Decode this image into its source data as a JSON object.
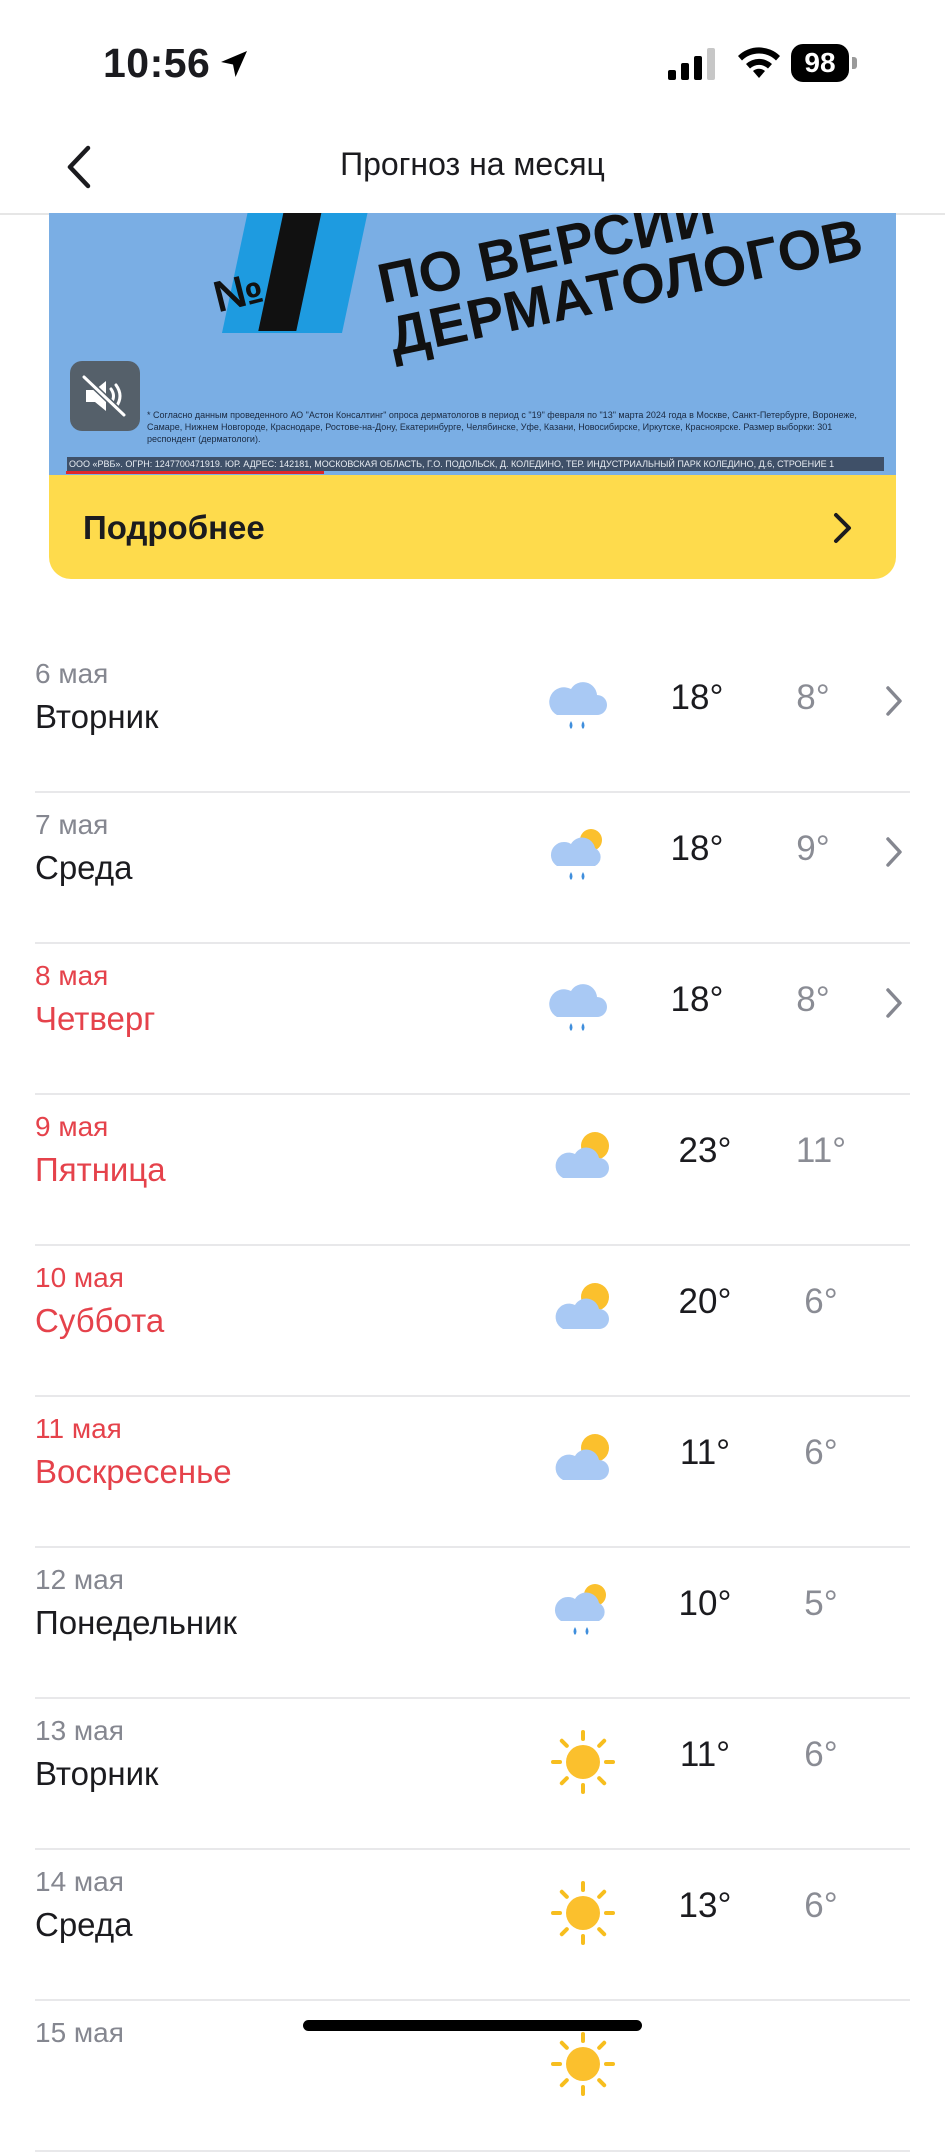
{
  "status_bar": {
    "time": "10:56",
    "battery": "98"
  },
  "nav": {
    "title": "Прогноз на месяц"
  },
  "ad": {
    "no_mark": "№",
    "headline": "ПО ВЕРСИИ\nДЕРМАТОЛОГОВ",
    "disclaimer": "* Согласно данным проведенного АО \"Астон Консалтинг\" опроса дерматологов в период с \"19\" февраля по \"13\" марта 2024 года в Москве, Санкт-Петербурге, Воронеже, Самаре, Нижнем Новгороде, Краснодаре, Ростове-на-Дону, Екатеринбурге, Челябинске, Уфе, Казани, Новосибирске, Иркутске, Красноярске. Размер выборки: 301 респондент (дерматологи).",
    "legal": "ООО «РВБ». ОГРН: 1247700471919. ЮР. АДРЕС: 142181, МОСКОВСКАЯ ОБЛАСТЬ, Г.О. ПОДОЛЬСК, Д. КОЛЕДИНО, ТЕР. ИНДУСТРИАЛЬНЫЙ ПАРК КОЛЕДИНО, Д.6, СТРОЕНИЕ 1",
    "cta_label": "Подробнее"
  },
  "days": [
    {
      "date": "6 мая",
      "weekday": "Вторник",
      "weekend": false,
      "icon": "cloud-rain-icon",
      "high": "18°",
      "low": "8°",
      "chevron": true
    },
    {
      "date": "7 мая",
      "weekday": "Среда",
      "weekend": false,
      "icon": "sun-cloud-rain-icon",
      "high": "18°",
      "low": "9°",
      "chevron": true
    },
    {
      "date": "8 мая",
      "weekday": "Четверг",
      "weekend": true,
      "icon": "cloud-rain-icon",
      "high": "18°",
      "low": "8°",
      "chevron": true
    },
    {
      "date": "9 мая",
      "weekday": "Пятница",
      "weekend": true,
      "icon": "partly-cloudy-icon",
      "high": "23°",
      "low": "11°",
      "chevron": false
    },
    {
      "date": "10 мая",
      "weekday": "Суббота",
      "weekend": true,
      "icon": "partly-cloudy-icon",
      "high": "20°",
      "low": "6°",
      "chevron": false
    },
    {
      "date": "11 мая",
      "weekday": "Воскресенье",
      "weekend": true,
      "icon": "partly-cloudy-icon",
      "high": "11°",
      "low": "6°",
      "chevron": false
    },
    {
      "date": "12 мая",
      "weekday": "Понедельник",
      "weekend": false,
      "icon": "sun-cloud-rain-icon",
      "high": "10°",
      "low": "5°",
      "chevron": false
    },
    {
      "date": "13 мая",
      "weekday": "Вторник",
      "weekend": false,
      "icon": "sun-icon",
      "high": "11°",
      "low": "6°",
      "chevron": false
    },
    {
      "date": "14 мая",
      "weekday": "Среда",
      "weekend": false,
      "icon": "sun-icon",
      "high": "13°",
      "low": "6°",
      "chevron": false
    },
    {
      "date": "15 мая",
      "weekday": "",
      "weekend": false,
      "icon": "sun-icon",
      "high": "",
      "low": "",
      "chevron": false
    }
  ]
}
